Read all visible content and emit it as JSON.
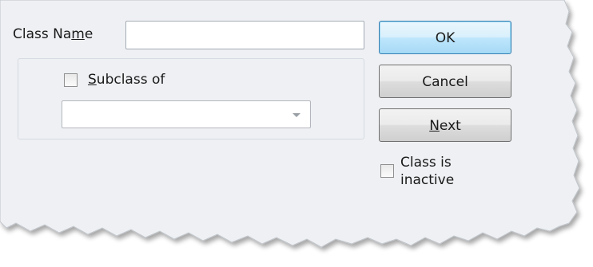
{
  "dialog": {
    "class_name_label_pre": "Class Na",
    "class_name_label_mnemonic": "m",
    "class_name_label_post": "e",
    "class_name_value": "",
    "subclass_label_mnemonic": "S",
    "subclass_label_rest": "ubclass of",
    "subclass_checked": false,
    "subclass_selected": "",
    "inactive_label_line1": "Class is",
    "inactive_label_line2": "inactive",
    "inactive_checked": false
  },
  "buttons": {
    "ok_label": "OK",
    "cancel_label": "Cancel",
    "next_mnemonic": "N",
    "next_rest": "ext"
  },
  "icons": {
    "combo_arrow": "chevron-down-icon"
  },
  "colors": {
    "default_button_border": "#3c7fb1",
    "default_button_fill": "#d9f0fc",
    "button_border": "#707070"
  }
}
